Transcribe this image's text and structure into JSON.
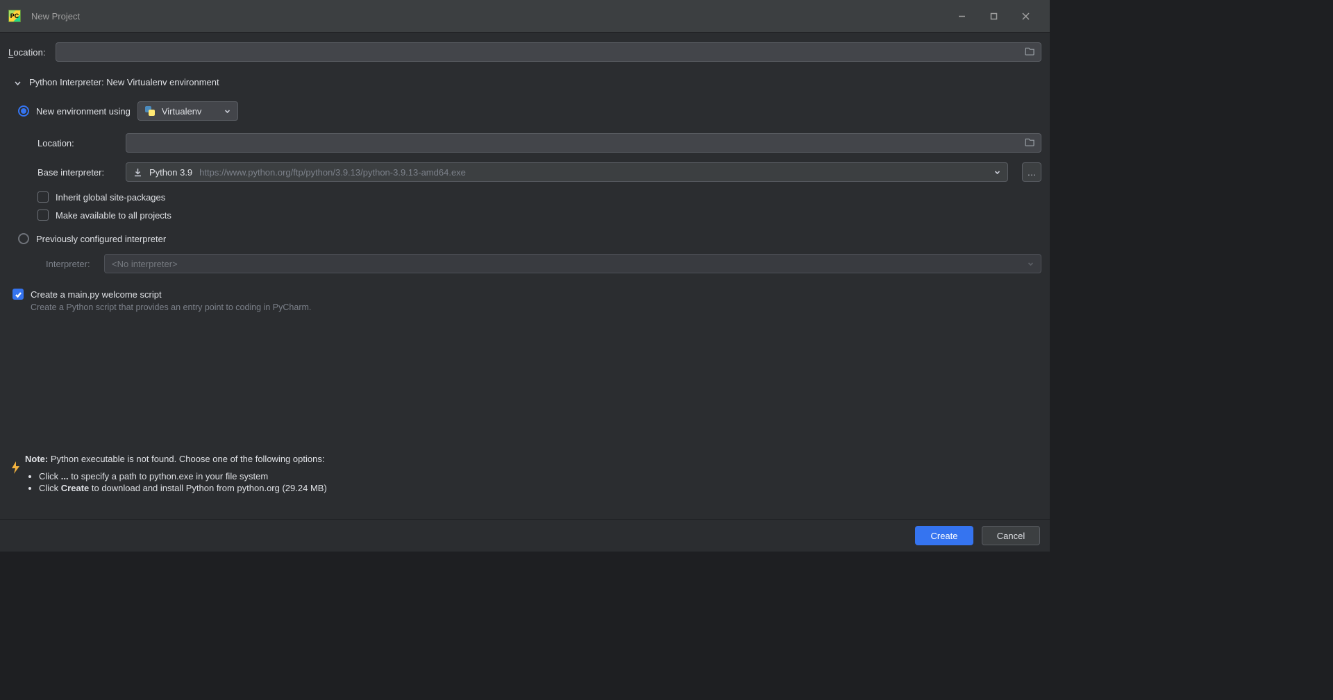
{
  "window": {
    "title": "New Project"
  },
  "location": {
    "label": "Location:",
    "value": ""
  },
  "interpreter_section": {
    "header": "Python Interpreter: New Virtualenv environment"
  },
  "new_env": {
    "radio_label": "New environment using",
    "tool": "Virtualenv",
    "location_label": "Location:",
    "location_value": "",
    "base_label": "Base interpreter:",
    "base_name": "Python 3.9",
    "base_url": "https://www.python.org/ftp/python/3.9.13/python-3.9.13-amd64.exe",
    "inherit_label": "Inherit global site-packages",
    "make_avail_label": "Make available to all projects"
  },
  "prev_env": {
    "radio_label": "Previously configured interpreter",
    "interpreter_label": "Interpreter:",
    "interpreter_value": "<No interpreter>"
  },
  "welcome": {
    "label": "Create a main.py welcome script",
    "description": "Create a Python script that provides an entry point to coding in PyCharm."
  },
  "note": {
    "prefix": "Note:",
    "text": " Python executable is not found. Choose one of the following options:",
    "bullet1_pre": "Click ",
    "bullet1_bold": "...",
    "bullet1_post": " to specify a path to python.exe in your file system",
    "bullet2_pre": "Click ",
    "bullet2_bold": "Create",
    "bullet2_post": " to download and install Python from python.org (29.24 MB)"
  },
  "footer": {
    "create": "Create",
    "cancel": "Cancel"
  }
}
